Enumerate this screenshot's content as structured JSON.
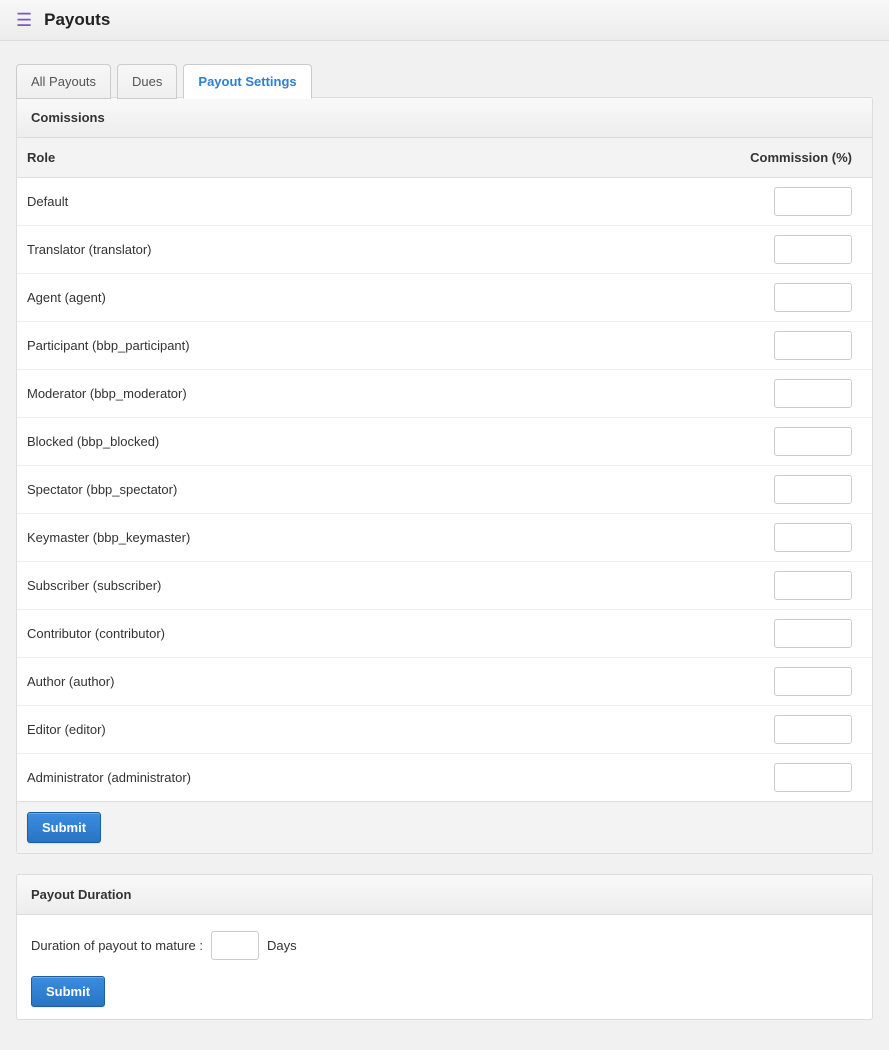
{
  "header": {
    "title": "Payouts"
  },
  "tabs": [
    {
      "label": "All Payouts",
      "active": false
    },
    {
      "label": "Dues",
      "active": false
    },
    {
      "label": "Payout Settings",
      "active": true
    }
  ],
  "commissions_panel": {
    "title": "Comissions",
    "columns": {
      "role": "Role",
      "commission": "Commission (%)"
    },
    "rows": [
      {
        "role": "Default",
        "value": ""
      },
      {
        "role": "Translator (translator)",
        "value": ""
      },
      {
        "role": "Agent (agent)",
        "value": ""
      },
      {
        "role": "Participant (bbp_participant)",
        "value": ""
      },
      {
        "role": "Moderator (bbp_moderator)",
        "value": ""
      },
      {
        "role": "Blocked (bbp_blocked)",
        "value": ""
      },
      {
        "role": "Spectator (bbp_spectator)",
        "value": ""
      },
      {
        "role": "Keymaster (bbp_keymaster)",
        "value": ""
      },
      {
        "role": "Subscriber (subscriber)",
        "value": ""
      },
      {
        "role": "Contributor (contributor)",
        "value": ""
      },
      {
        "role": "Author (author)",
        "value": ""
      },
      {
        "role": "Editor (editor)",
        "value": ""
      },
      {
        "role": "Administrator (administrator)",
        "value": ""
      }
    ],
    "submit_label": "Submit"
  },
  "duration_panel": {
    "title": "Payout Duration",
    "label_prefix": "Duration of payout to mature :",
    "value": "",
    "label_suffix": "Days",
    "submit_label": "Submit"
  }
}
